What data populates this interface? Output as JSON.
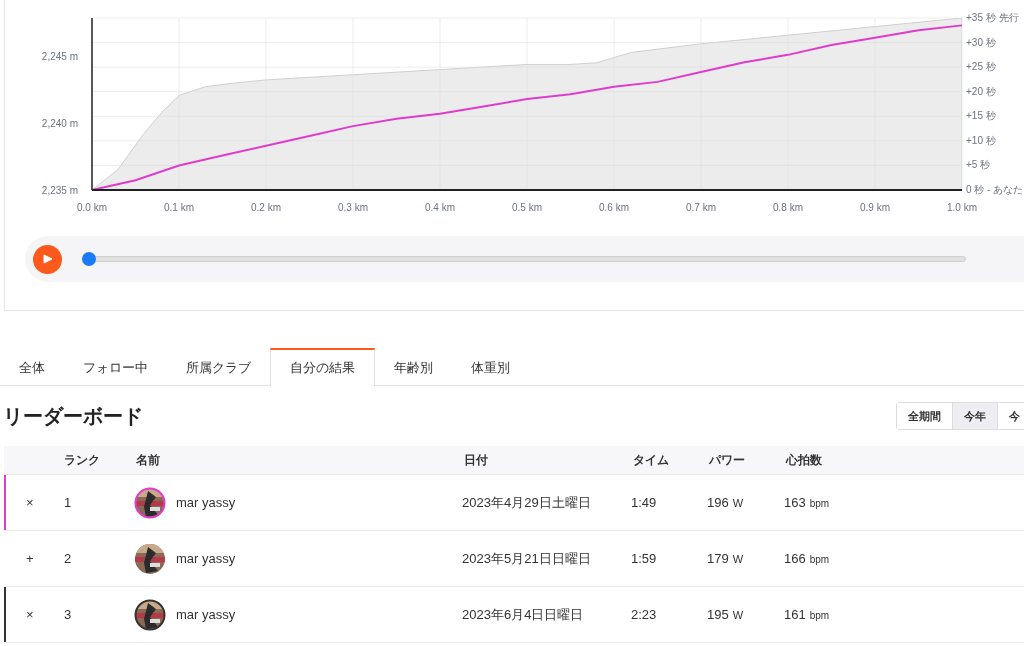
{
  "elevation": {
    "labels": [
      "2,245 m",
      "2,240 m",
      "2,235 m"
    ]
  },
  "chart": {
    "chart_data": {
      "type": "line",
      "grid": true,
      "x": [
        0,
        0.05,
        0.1,
        0.15,
        0.2,
        0.25,
        0.3,
        0.35,
        0.4,
        0.45,
        0.5,
        0.55,
        0.6,
        0.65,
        0.7,
        0.75,
        0.8,
        0.85,
        0.9,
        0.95,
        1
      ],
      "values": [
        0,
        2,
        5,
        7,
        9,
        11,
        13,
        14.5,
        15.5,
        17,
        18.5,
        19.5,
        21,
        22,
        24,
        26,
        27.5,
        29.5,
        31,
        32.5,
        33.5
      ],
      "xlim": [
        0,
        1
      ],
      "ylim": [
        0,
        35
      ],
      "xticks": [
        {
          "value": 0,
          "label": "0.0 km"
        },
        {
          "value": 0.1,
          "label": "0.1 km"
        },
        {
          "value": 0.2,
          "label": "0.2 km"
        },
        {
          "value": 0.3,
          "label": "0.3 km"
        },
        {
          "value": 0.4,
          "label": "0.4 km"
        },
        {
          "value": 0.5,
          "label": "0.5 km"
        },
        {
          "value": 0.6,
          "label": "0.6 km"
        },
        {
          "value": 0.7,
          "label": "0.7 km"
        },
        {
          "value": 0.8,
          "label": "0.8 km"
        },
        {
          "value": 0.9,
          "label": "0.9 km"
        },
        {
          "value": 1,
          "label": "1.0 km"
        }
      ],
      "yticks": [
        {
          "value": 35,
          "label": "+35 秒 先行"
        },
        {
          "value": 30,
          "label": "+30 秒"
        },
        {
          "value": 25,
          "label": "+25 秒"
        },
        {
          "value": 20,
          "label": "+20 秒"
        },
        {
          "value": 15,
          "label": "+15 秒"
        },
        {
          "value": 10,
          "label": "+10 秒"
        },
        {
          "value": 5,
          "label": "+5 秒"
        },
        {
          "value": 0,
          "label": "0 秒 - あなた"
        }
      ]
    }
  },
  "player": {
    "level": 0
  },
  "tabs": [
    {
      "label": "全体",
      "selected": false
    },
    {
      "label": "フォロー中",
      "selected": false
    },
    {
      "label": "所属クラブ",
      "selected": false
    },
    {
      "label": "自分の結果",
      "selected": true
    },
    {
      "label": "年齢別",
      "selected": false
    },
    {
      "label": "体重別",
      "selected": false
    }
  ],
  "leaderboard": {
    "title": "リーダーボード",
    "periods": [
      {
        "label": "全期間",
        "selected": false
      },
      {
        "label": "今年",
        "selected": true
      },
      {
        "label": "今",
        "selected": false
      }
    ],
    "columns": [
      "ランク",
      "名前",
      "日付",
      "タイム",
      "パワー",
      "心拍数"
    ],
    "rows": [
      {
        "toggle": "×",
        "rank": "1",
        "name": "mar yassy",
        "date": "2023年4月29日土曜日",
        "time": "1:49",
        "power": "196",
        "power_unit": "W",
        "hr": "163",
        "hr_unit": "bpm",
        "color": "#e03ccb"
      },
      {
        "toggle": "+",
        "rank": "2",
        "name": "mar yassy",
        "date": "2023年5月21日日曜日",
        "time": "1:59",
        "power": "179",
        "power_unit": "W",
        "hr": "166",
        "hr_unit": "bpm"
      },
      {
        "toggle": "×",
        "rank": "3",
        "name": "mar yassy",
        "date": "2023年6月4日日曜日",
        "time": "2:23",
        "power": "195",
        "power_unit": "W",
        "hr": "161",
        "hr_unit": "bpm",
        "color": "#333333"
      }
    ]
  }
}
